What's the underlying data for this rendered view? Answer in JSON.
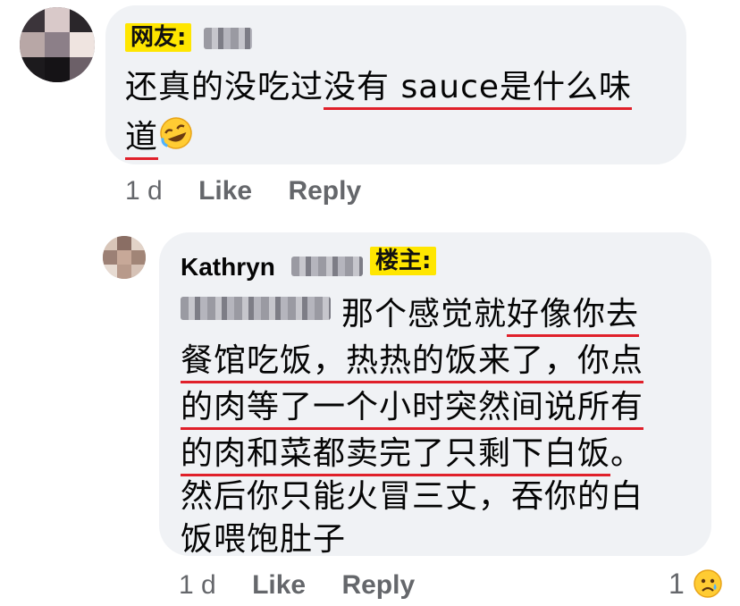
{
  "comment1": {
    "author_tag": "网友:",
    "text_line1_plain": "还真的没吃过",
    "text_line1_underlined": "没有 sauce是什么味",
    "text_line2_underlined": "道",
    "emoji_icon": "rolling-on-floor-laughing-icon",
    "time": "1 d",
    "like_label": "Like",
    "reply_label": "Reply"
  },
  "reply1": {
    "author_name": "Kathryn",
    "author_tag": "楼主:",
    "line1_plain": "那个感觉就",
    "line1_underlined": "好像你去",
    "line2": "餐馆吃饭，热热的饭来了，你点",
    "line3": "的肉等了一个小时突然间说所有",
    "line4_underlined": "的肉和菜都卖完了只剩下白饭",
    "line4_tail": "。",
    "line5": "然后你只能火冒三丈，吞你的白",
    "line6": "饭喂饱肚子",
    "time": "1 d",
    "like_label": "Like",
    "reply_label": "Reply",
    "reaction_count": "1",
    "reaction_icon": "sad-tear-face-icon"
  }
}
